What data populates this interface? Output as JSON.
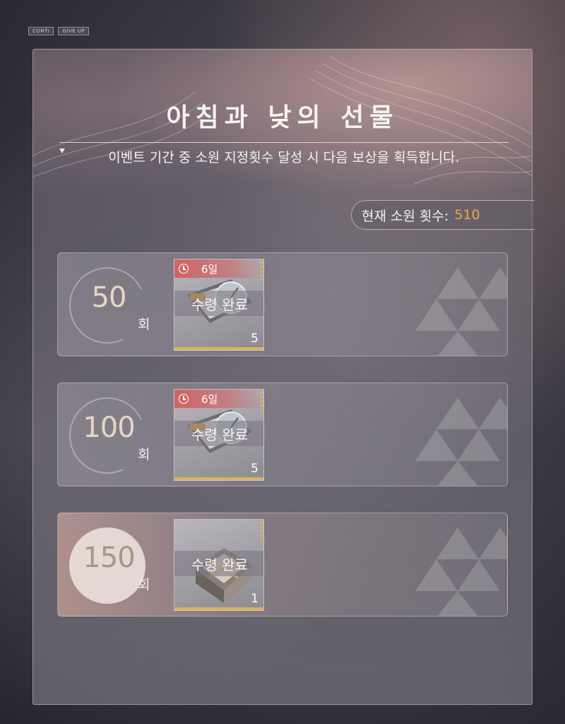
{
  "header": {
    "tags": [
      "CONTI",
      "GIVE UP"
    ]
  },
  "event": {
    "title": "아침과 낮의 선물",
    "description": "이벤트 기간 중 소원 지정횟수 달성 시 다음 보상을 획득합니다.",
    "count_label": "현재 소원 횟수:",
    "count_value": "510"
  },
  "rewards": [
    {
      "threshold": "50",
      "unit": "회",
      "timer": "6일",
      "status": "수령 완료",
      "quantity": "5",
      "item_icon": "ticket-box-icon"
    },
    {
      "threshold": "100",
      "unit": "회",
      "timer": "6일",
      "status": "수령 완료",
      "quantity": "5",
      "item_icon": "ticket-box-icon"
    },
    {
      "threshold": "150",
      "unit": "회",
      "status": "수령 완료",
      "quantity": "1",
      "item_icon": "gift-box-icon"
    }
  ],
  "colors": {
    "accent": "#f0a64a",
    "timer_tag": "#d25a5a",
    "rarity": "#d9b35a"
  }
}
